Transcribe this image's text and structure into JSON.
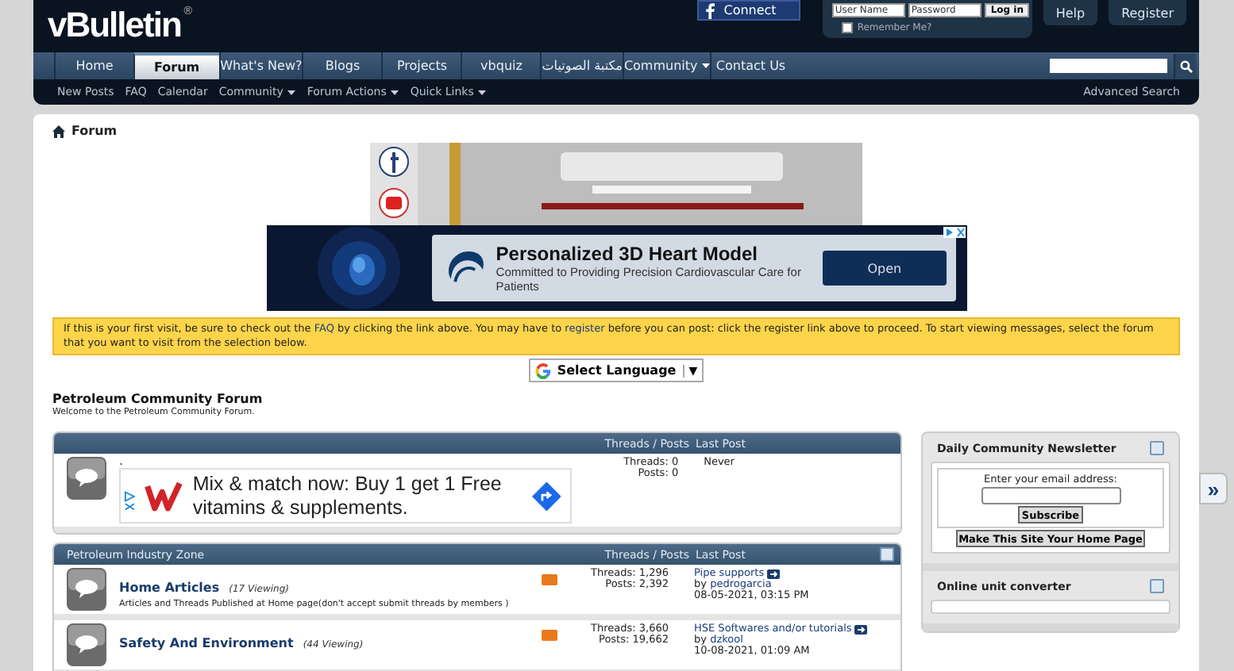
{
  "header": {
    "logo": "vBulletin",
    "logo_mark": "®",
    "connect": "Connect",
    "login": {
      "username_placeholder": "User Name",
      "password_placeholder": "Password",
      "button": "Log in",
      "remember": {
        "label": "Remember Me?",
        "checked": false
      }
    },
    "buttons": [
      "Help",
      "Register"
    ]
  },
  "nav": {
    "tabs": [
      {
        "label": "Home",
        "selected": false,
        "has_menu": false
      },
      {
        "label": "Forum",
        "selected": true,
        "has_menu": false
      },
      {
        "label": "What's New?",
        "selected": false,
        "has_menu": false
      },
      {
        "label": "Blogs",
        "selected": false,
        "has_menu": false
      },
      {
        "label": "Projects",
        "selected": false,
        "has_menu": false
      },
      {
        "label": "vbquiz",
        "selected": false,
        "has_menu": false
      },
      {
        "label": "مكتبة الصوتيات",
        "selected": false,
        "has_menu": false
      },
      {
        "label": "Community",
        "selected": false,
        "has_menu": true
      },
      {
        "label": "Contact Us",
        "selected": false,
        "has_menu": false
      }
    ]
  },
  "subnav": {
    "items": [
      {
        "label": "New Posts",
        "has_menu": false
      },
      {
        "label": "FAQ",
        "has_menu": false
      },
      {
        "label": "Calendar",
        "has_menu": false
      },
      {
        "label": "Community",
        "has_menu": true
      },
      {
        "label": "Forum Actions",
        "has_menu": true
      },
      {
        "label": "Quick Links",
        "has_menu": true
      }
    ],
    "advanced_search": "Advanced Search"
  },
  "breadcrumb": "Forum",
  "ad": {
    "title": "Personalized 3D Heart Model",
    "text": "Committed to Providing Precision Cardiovascular Care for Patients",
    "button": "Open"
  },
  "notice": [
    {
      "kind": "text",
      "text": "If this is your first visit, be sure to check out the "
    },
    {
      "kind": "link",
      "text": "FAQ"
    },
    {
      "kind": "text",
      "text": " by clicking the link above. You may have to "
    },
    {
      "kind": "link",
      "text": "register"
    },
    {
      "kind": "text",
      "text": " before you can post: click the register link above to proceed. To start viewing messages, select the forum that you want to visit from the selection below."
    }
  ],
  "language": {
    "label": "Select Language",
    "arrow": "▼"
  },
  "forum_title": "Petroleum Community Forum",
  "welcome": "Welcome to the Petroleum Community Forum.",
  "sections": [
    {
      "collapsible": false,
      "columns": [
        "Threads / Posts",
        "Last Post"
      ],
      "rows": [
        {
          "kind": "ad",
          "name": ".",
          "ad_text": "Mix & match now: Buy 1 get 1 Free vitamins & supplements.",
          "threads": "Threads: 0",
          "posts": "Posts: 0",
          "last": "Never"
        }
      ]
    },
    {
      "title": "Petroleum Industry Zone",
      "collapsible": true,
      "columns": [
        "Threads / Posts",
        "Last Post"
      ],
      "rows": [
        {
          "kind": "forum",
          "name": "Home Articles",
          "viewing": "(17 Viewing)",
          "description": "Articles and Threads Published at Home page(don't accept submit threads by members )",
          "threads": "Threads: 1,296",
          "posts": "Posts: 2,392",
          "last_title": "Pipe supports",
          "by": "by",
          "user": "pedrogarcia",
          "date": "08-05-2021, 03:15 PM"
        },
        {
          "kind": "forum",
          "name": "Safety And Environment",
          "viewing": "(44 Viewing)",
          "threads": "Threads: 3,660",
          "posts": "Posts: 19,662",
          "last_title": "HSE Softwares and/or tutorials",
          "by": "by",
          "user": "dzkool",
          "date": "10-08-2021, 01:09 AM"
        }
      ]
    }
  ],
  "sidebar": {
    "blocks": [
      {
        "kind": "newsletter",
        "title": "Daily Community Newsletter",
        "label": "Enter your email address:",
        "subscribe": "Subscribe",
        "homepage": "Make This Site Your Home Page"
      },
      {
        "kind": "empty",
        "title": "Online unit converter"
      }
    ],
    "toggle": "»"
  }
}
